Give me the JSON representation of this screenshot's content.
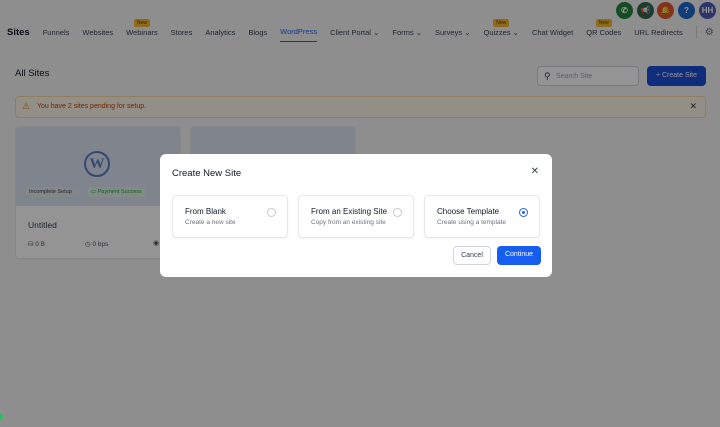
{
  "header": {
    "icons": [
      {
        "name": "phone-icon",
        "color": "#22863a"
      },
      {
        "name": "megaphone-icon",
        "color": "#2d6a4f"
      },
      {
        "name": "bell-icon",
        "color": "#e2572b"
      },
      {
        "name": "help-icon",
        "color": "#1e66d0"
      },
      {
        "name": "avatar",
        "label": "HH",
        "color": "#4f5bb5"
      }
    ]
  },
  "nav": {
    "brand": "Sites",
    "items": [
      {
        "label": "Funnels"
      },
      {
        "label": "Websites"
      },
      {
        "label": "Webinars",
        "badge": "New"
      },
      {
        "label": "Stores"
      },
      {
        "label": "Analytics"
      },
      {
        "label": "Blogs"
      },
      {
        "label": "WordPress",
        "active": true
      },
      {
        "label": "Client Portal",
        "dropdown": true
      },
      {
        "label": "Forms",
        "dropdown": true
      },
      {
        "label": "Surveys",
        "dropdown": true
      },
      {
        "label": "Quizzes",
        "dropdown": true,
        "badge": "New"
      },
      {
        "label": "Chat Widget"
      },
      {
        "label": "QR Codes",
        "badge": "New"
      },
      {
        "label": "URL Redirects"
      }
    ]
  },
  "page": {
    "title": "All Sites",
    "search_placeholder": "Search Site",
    "create_label": "Create Site",
    "banner": "You have 2 sites pending for setup."
  },
  "cards": [
    {
      "status": "Incomplete Setup",
      "payment": "Payment Success",
      "name": "Untitled",
      "storage": "0 B",
      "bandwidth": "0 bps"
    }
  ],
  "modal": {
    "title": "Create New Site",
    "options": [
      {
        "title": "From Blank",
        "subtitle": "Create a new site",
        "selected": false
      },
      {
        "title": "From an Existing Site",
        "subtitle": "Copy from an existing site",
        "selected": false
      },
      {
        "title": "Choose Template",
        "subtitle": "Create using a template",
        "selected": true
      }
    ],
    "cancel": "Cancel",
    "continue": "Continue"
  }
}
